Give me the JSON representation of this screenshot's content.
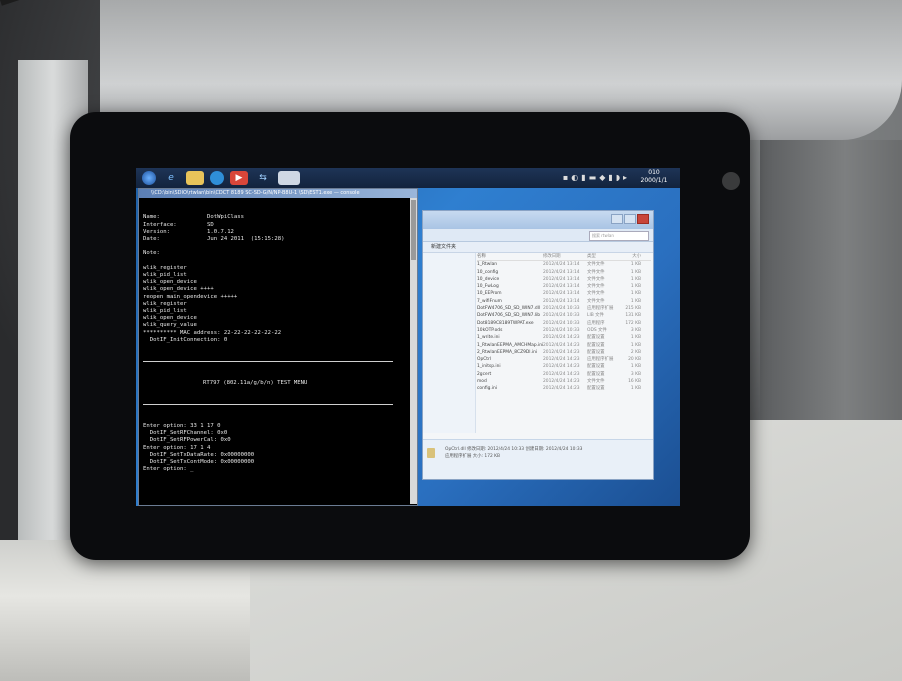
{
  "taskbar": {
    "buttons": [
      "start-orb",
      "ie-browser",
      "file-explorer",
      "media-center",
      "media-player",
      "network-app",
      "console-window"
    ],
    "clock_time": "010",
    "clock_date": "2000/1/1"
  },
  "console": {
    "window_title": "\\\\CD:\\bin\\SDIO\\rtwlan\\bin\\CDCT 8189 SC-SD-G/N/NP-B8U-1 \\SD\\EST1.exe  —  console",
    "lines": [
      "Name:              DotWpiClass",
      "Interface:         SD",
      "Version:           1.0.7.12",
      "Date:              Jun 24 2011  (15:15:28)",
      "",
      "Note:",
      "",
      "wlik_register",
      "wlik_pid_list",
      "wlik_open_device",
      "wlik_open_device ++++",
      "reopen main_opendevice +++++",
      "wlik_register",
      "wlik_pid_list",
      "wlik_open_device",
      "wlik_query_value",
      "********** MAC address: 22-22-22-22-22-22",
      "  DotIF_InitConnection: 0"
    ],
    "menu_title": "RT797 (802.11a/g/b/n) TEST MENU",
    "lines2": [
      "Enter option: 33 1 17 0",
      "  DotIF_SetRFChannel: 0x0",
      "  DotIF_SetRFPowerCal: 0x0",
      "Enter option: 17 1 4",
      "  DotIF_SetTxDataRate: 0x00000000",
      "  DotIF_SetTxContMode: 0x00000000",
      "Enter option: _"
    ]
  },
  "explorer": {
    "search_placeholder": "搜索 rtwlan",
    "toolbar_label": "新建文件夹",
    "columns": [
      "名称",
      "修改日期",
      "类型",
      "大小"
    ],
    "files": [
      [
        "1_Rtwlan",
        "2012/4/24 13:14",
        "文件文件",
        "1 KB"
      ],
      [
        "10_config",
        "2012/4/24 13:14",
        "文件文件",
        "1 KB"
      ],
      [
        "10_device",
        "2012/4/24 13:14",
        "文件文件",
        "1 KB"
      ],
      [
        "10_FwLog",
        "2012/4/24 13:14",
        "文件文件",
        "1 KB"
      ],
      [
        "10_EEProm",
        "2012/4/24 13:14",
        "文件文件",
        "1 KB"
      ],
      [
        "7_wifiFnum",
        "2012/4/24 13:14",
        "文件文件",
        "1 KB"
      ],
      [
        "DotFW4706_SD_SD_WIN7.dll",
        "2012/4/24 10:33",
        "应用程序扩展",
        "215 KB"
      ],
      [
        "DotFW4706_SD_SD_WIN7.lib",
        "2012/4/24 10:33",
        "LIB 文件",
        "131 KB"
      ],
      [
        "Dot8189C8189TWPAT.exe",
        "2012/4/24 10:33",
        "应用程序",
        "172 KB"
      ],
      [
        "10kOTP.ods",
        "2012/4/24 10:33",
        "ODS 文件",
        "3 KB"
      ],
      [
        "1_write.ini",
        "2012/4/24 14:23",
        "配置设置",
        "1 KB"
      ],
      [
        "1_RtwlanEEPMA_AMCHMap.ini",
        "2012/4/24 14:23",
        "配置设置",
        "1 KB"
      ],
      [
        "2_RtwlanEEPMA_8CZ9Dl.ini",
        "2012/4/24 14:23",
        "配置设置",
        "2 KB"
      ],
      [
        "OpCtrl",
        "2012/4/24 14:23",
        "应用程序扩展",
        "20 KB"
      ],
      [
        "1_initsp.ini",
        "2012/4/24 14:23",
        "配置设置",
        "1 KB"
      ],
      [
        "2gcert",
        "2012/4/24 14:23",
        "配置设置",
        "3 KB"
      ],
      [
        "mod",
        "2012/4/24 14:23",
        "文件文件",
        "16 KB"
      ],
      [
        "config.ini",
        "2012/4/24 14:23",
        "配置设置",
        "1 KB"
      ]
    ],
    "status_line1": "OpCtrl.dll  修改日期: 2012/4/24 10:33    创建日期: 2012/4/24 10:33",
    "status_line2": "应用程序扩展    大小: 172 KB"
  }
}
